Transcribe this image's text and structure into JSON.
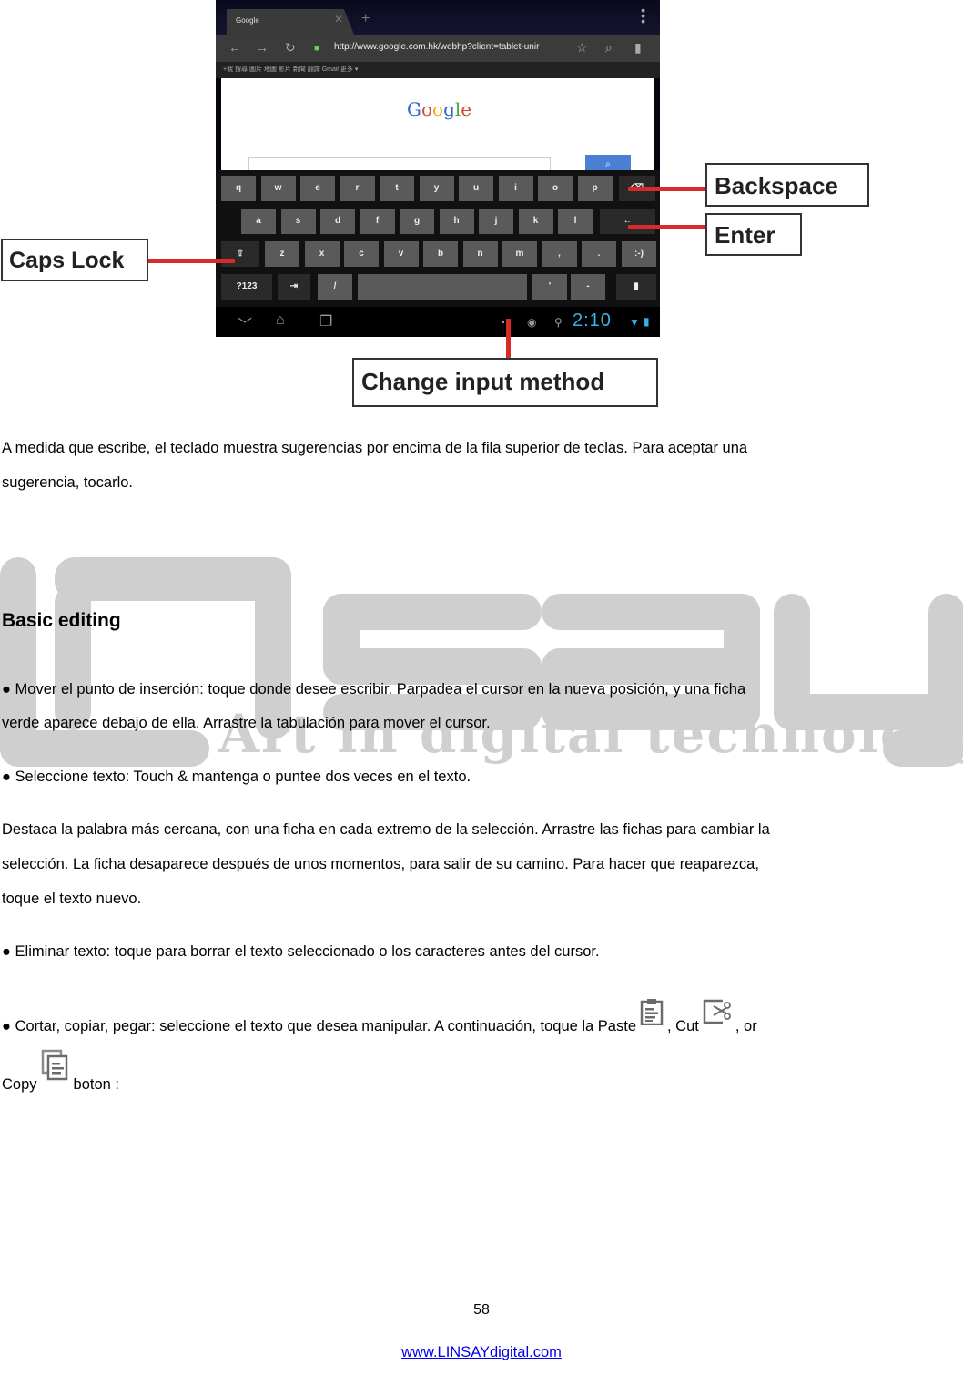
{
  "figure": {
    "browser": {
      "tab_title": "Google",
      "url": "http://www.google.com.hk/webhp?client=tablet-unir",
      "bookmarks": "+我  搜尋  圖片  地圖  影片  新聞  翻譯  Gmail  更多 ▾",
      "logo_text": "Google",
      "colors": {
        "logo_blue": "#3366cc",
        "logo_red": "#d14836",
        "logo_yellow": "#e8b123",
        "logo_green": "#4ca340",
        "search_button": "#4a7fd4"
      }
    },
    "keyboard": {
      "row1": [
        "q",
        "w",
        "e",
        "r",
        "t",
        "y",
        "u",
        "i",
        "o",
        "p"
      ],
      "row2": [
        "a",
        "s",
        "d",
        "f",
        "g",
        "h",
        "j",
        "k",
        "l"
      ],
      "row3": [
        "z",
        "x",
        "c",
        "v",
        "b",
        "n",
        "m",
        ",",
        "."
      ],
      "smiley_key": ":-)",
      "symbols_key": "?123",
      "slash_key": "/",
      "apostrophe_key": "'",
      "dash_key": "-"
    },
    "status_bar": {
      "clock": "2:10"
    },
    "callouts": {
      "backspace": "Backspace",
      "enter": "Enter",
      "caps_lock": "Caps Lock",
      "change_input": "Change input method"
    },
    "leader_color": "#d92a2a"
  },
  "text": {
    "intro_line1": "A medida que escribe, el teclado muestra sugerencias por encima de la fila superior de teclas. Para aceptar una",
    "intro_line2": "sugerencia, tocarlo.",
    "heading": "Basic editing",
    "b1_line1": "● Mover el punto de inserción: toque donde desee escribir. Parpadea el cursor en la nueva posición, y una ficha",
    "b1_line2": "verde aparece debajo de ella. Arrastre la tabulación para mover el cursor.",
    "b2": "●  Seleccione texto: Touch & mantenga o puntee dos veces en el texto.",
    "p_line1": "Destaca la palabra más cercana, con una ficha en cada extremo de la selección. Arrastre las fichas para cambiar la",
    "p_line2": "selección. La ficha desaparece después de unos momentos, para salir de su camino. Para hacer que reaparezca,",
    "p_line3": "toque el texto nuevo.",
    "b3": "● Eliminar texto: toque para borrar el texto seleccionado o los caracteres antes del cursor.",
    "b4_part1": "● Cortar, copiar, pegar: seleccione el texto que desea manipular. A continuación, toque la Paste",
    "b4_part2": ", Cut",
    "b4_part3": ", or",
    "b4_line2_part1": "Copy",
    "b4_line2_part2": "boton :"
  },
  "icons": {
    "paste": "paste-icon",
    "cut": "cut-icon",
    "copy": "copy-icon"
  },
  "watermark": {
    "tagline": "Art in digital technology"
  },
  "footer": {
    "page_number": "58",
    "link": "www.LINSAYdigital.com",
    "link_color": "#0000ee"
  }
}
